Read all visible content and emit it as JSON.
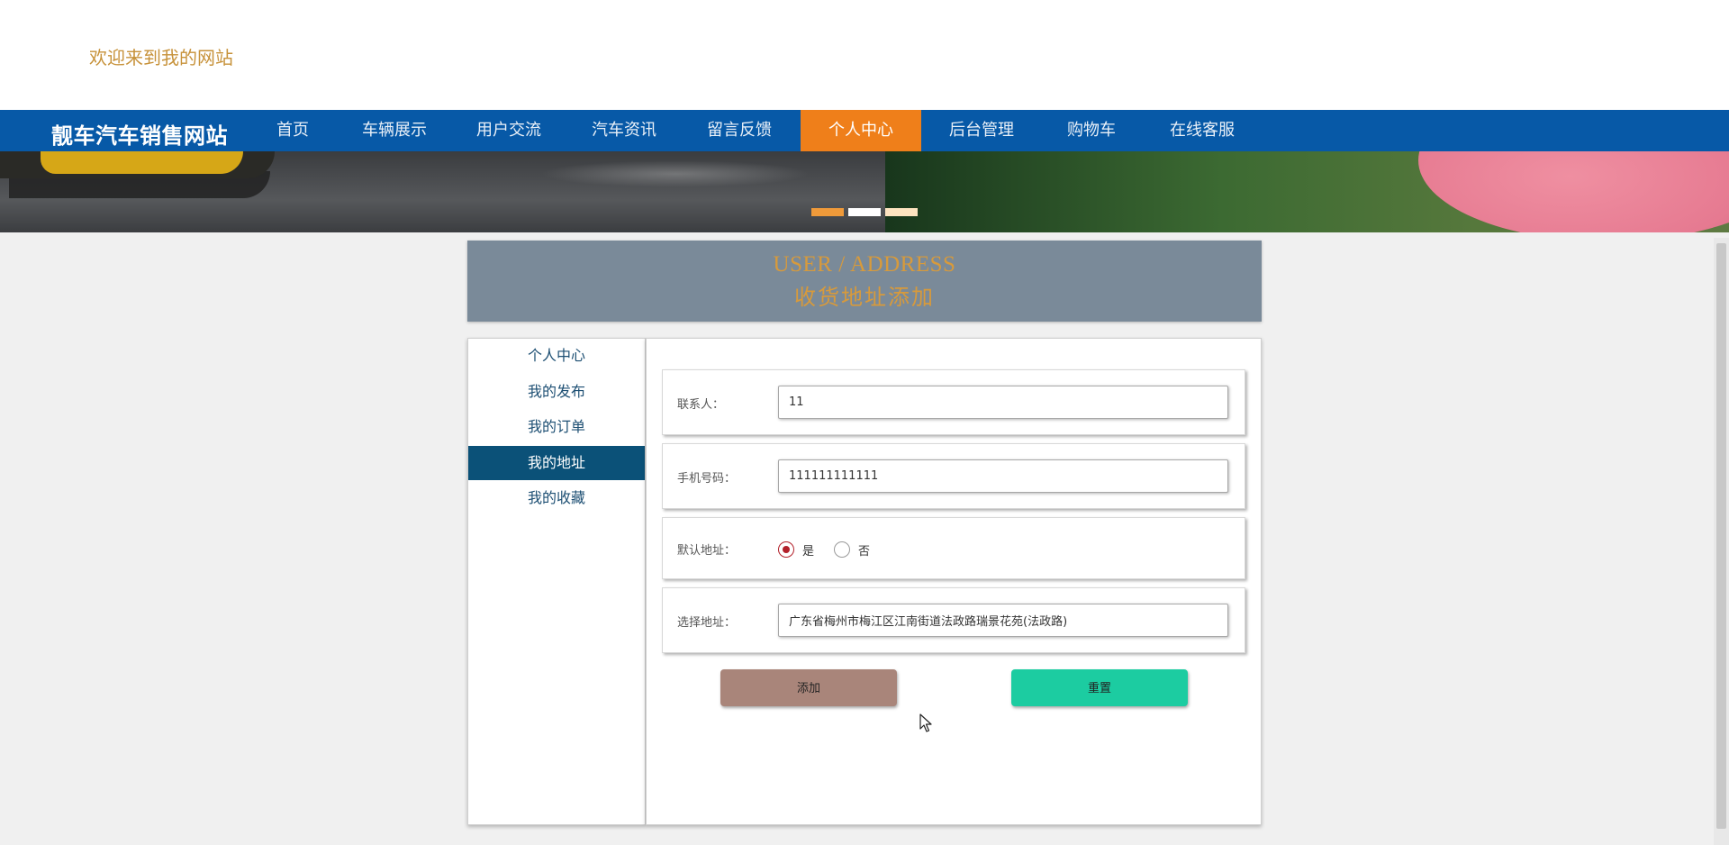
{
  "header": {
    "welcome_text": "欢迎来到我的网站"
  },
  "navbar": {
    "brand": "靓车汽车销售网站",
    "items": [
      {
        "label": "首页"
      },
      {
        "label": "车辆展示"
      },
      {
        "label": "用户交流"
      },
      {
        "label": "汽车资讯"
      },
      {
        "label": "留言反馈"
      },
      {
        "label": "个人中心",
        "active": true
      },
      {
        "label": "后台管理"
      },
      {
        "label": "购物车"
      },
      {
        "label": "在线客服"
      }
    ],
    "colors": {
      "bg": "#0759a7",
      "active_bg": "#ef7f1a"
    }
  },
  "banner": {
    "indicators": [
      {
        "color": "#ef9a3a",
        "active": true
      },
      {
        "color": "#ffffff",
        "active": false
      },
      {
        "color": "#fde3c0",
        "active": false
      }
    ]
  },
  "section": {
    "title_en": "USER / ADDRESS",
    "title_cn": "收货地址添加"
  },
  "sidebar": {
    "items": [
      {
        "label": "个人中心"
      },
      {
        "label": "我的发布"
      },
      {
        "label": "我的订单"
      },
      {
        "label": "我的地址",
        "active": true
      },
      {
        "label": "我的收藏"
      }
    ]
  },
  "form": {
    "contact": {
      "label": "联系人：",
      "value": "11"
    },
    "phone": {
      "label": "手机号码：",
      "value": "111111111111"
    },
    "default_address": {
      "label": "默认地址：",
      "options": [
        {
          "label": "是",
          "checked": true
        },
        {
          "label": "否",
          "checked": false
        }
      ]
    },
    "address": {
      "label": "选择地址：",
      "value": "广东省梅州市梅江区江南街道法政路瑞景花苑(法政路)"
    },
    "add_button": "添加",
    "reset_button": "重置"
  },
  "icons": {
    "cursor": "mouse-pointer-icon"
  }
}
